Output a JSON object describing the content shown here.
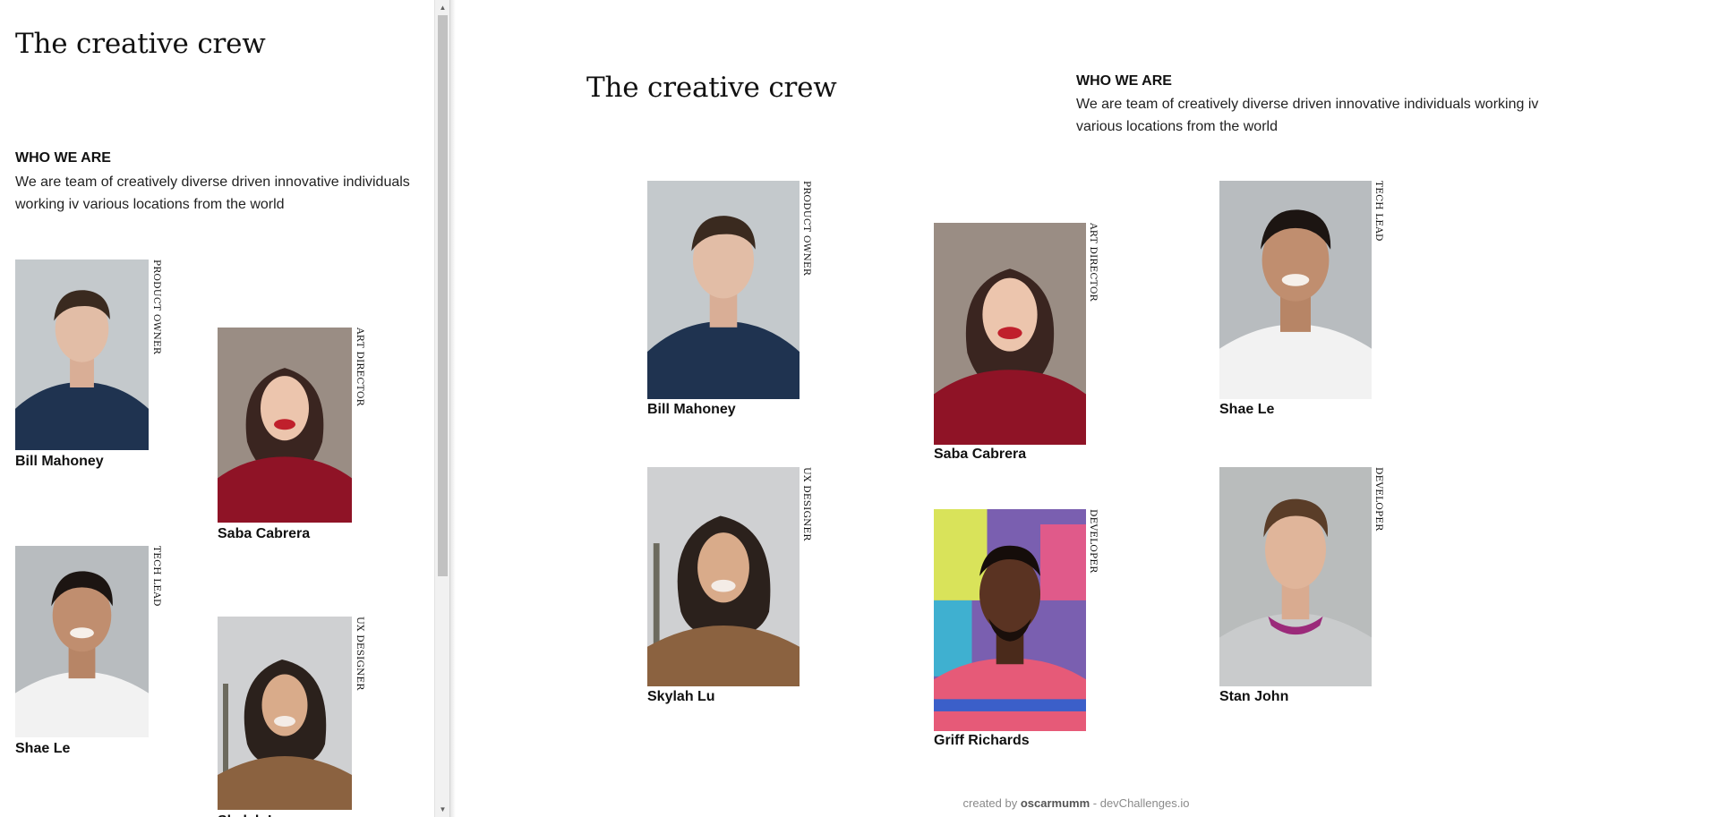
{
  "page": {
    "title": "The creative crew",
    "who_heading": "WHO WE ARE",
    "description": "We are team of creatively diverse driven innovative individuals working iv various locations from the world"
  },
  "members": [
    {
      "name": "Bill Mahoney",
      "role": "PRODUCT OWNER"
    },
    {
      "name": "Saba Cabrera",
      "role": "ART DIRECTOR"
    },
    {
      "name": "Shae Le",
      "role": "TECH LEAD"
    },
    {
      "name": "Skylah Lu",
      "role": "UX DESIGNER"
    },
    {
      "name": "Griff Richards",
      "role": "DEVELOPER"
    },
    {
      "name": "Stan John",
      "role": "DEVELOPER"
    }
  ],
  "footer": {
    "prefix": "created by",
    "author": "oscarmumm",
    "suffix": "- devChallenges.io"
  },
  "icons": {
    "scroll_up": "scroll-up-arrow-icon",
    "scroll_down": "scroll-down-arrow-icon"
  },
  "colors": {
    "text": "#111111",
    "scrollbar_track": "#f1f1f1",
    "scrollbar_thumb": "#c1c1c1"
  }
}
